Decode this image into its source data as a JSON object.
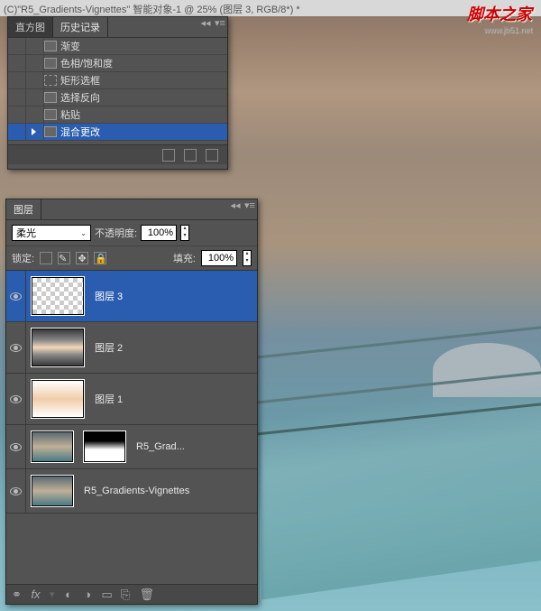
{
  "titlebar": "(C)\"R5_Gradients-Vignettes\" 智能对象-1 @ 25% (图层 3, RGB/8*) *",
  "watermark": {
    "title": "脚本之家",
    "url": "www.jb51.net"
  },
  "history": {
    "tabs": {
      "histogram": "直方图",
      "history": "历史记录"
    },
    "items": [
      {
        "label": "渐变"
      },
      {
        "label": "色相/饱和度"
      },
      {
        "label": "矩形选框"
      },
      {
        "label": "选择反向"
      },
      {
        "label": "粘贴"
      },
      {
        "label": "混合更改"
      }
    ]
  },
  "layers": {
    "tab": "图层",
    "blend_mode": "柔光",
    "opacity_label": "不透明度:",
    "opacity_value": "100%",
    "lock_label": "锁定:",
    "fill_label": "填充:",
    "fill_value": "100%",
    "items": [
      {
        "name": "图层 3",
        "selected": true,
        "thumb": "checker"
      },
      {
        "name": "图层 2",
        "thumb": "grad-h"
      },
      {
        "name": "图层 1",
        "thumb": "grad-r"
      },
      {
        "name": "R5_Grad...",
        "thumb": "photo",
        "mask": true
      },
      {
        "name": "R5_Gradients-Vignettes",
        "thumb": "photo"
      }
    ],
    "footer_icons": [
      "link",
      "fx",
      "mask",
      "adjust",
      "group",
      "new",
      "trash"
    ]
  }
}
